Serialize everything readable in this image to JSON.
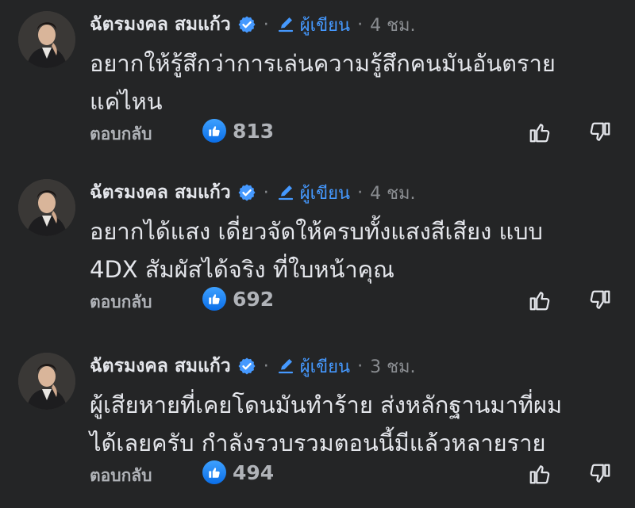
{
  "comments": [
    {
      "author": "ฉัตรมงคล สมแก้ว",
      "separator": "·",
      "role": "ผู้เขียน",
      "time": "4 ชม.",
      "text": "อยากให้รู้สึกว่าการเล่นความรู้สึกคนมันอันตราย\nแค่ไหน",
      "reply_label": "ตอบกลับ",
      "like_count": "813"
    },
    {
      "author": "ฉัตรมงคล สมแก้ว",
      "separator": "·",
      "role": "ผู้เขียน",
      "time": "4 ชม.",
      "text": "อยากได้แสง เดี่ยวจัดให้ครบทั้งแสงสีเสียง แบบ\n4DX สัมผัสได้จริง ที่ใบหน้าคุณ",
      "reply_label": "ตอบกลับ",
      "like_count": "692"
    },
    {
      "author": "ฉัตรมงคล สมแก้ว",
      "separator": "·",
      "role": "ผู้เขียน",
      "time": "3 ชม.",
      "text": "ผู้เสียหายที่เคยโดนมันทำร้าย ส่งหลักฐานมาที่ผม\nได้เลยครับ กำลังรวบรวมตอนนี้มีแล้วหลายราย",
      "reply_label": "ตอบกลับ",
      "like_count": "494"
    }
  ],
  "colors": {
    "background": "#242526",
    "text": "#e4e6eb",
    "muted": "#b0b3b8",
    "accent": "#4599ff"
  }
}
